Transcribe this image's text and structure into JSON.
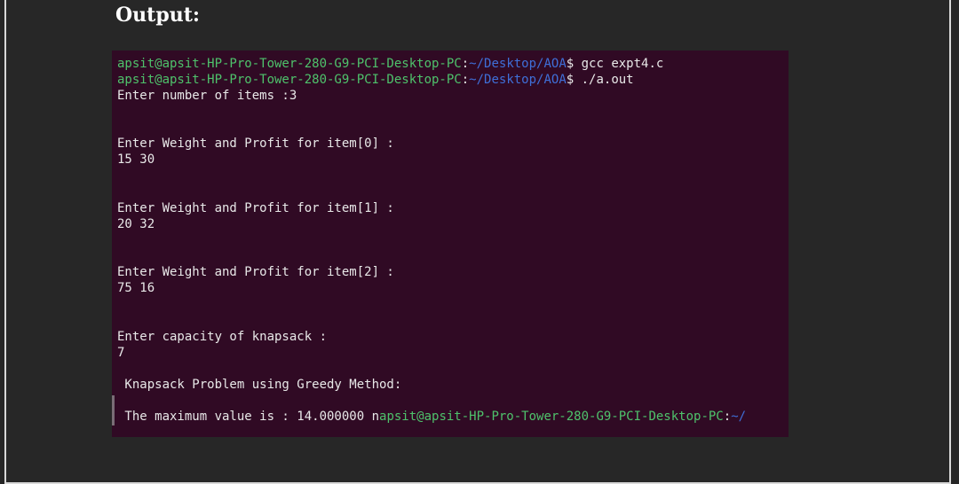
{
  "heading": "Output:",
  "terminal": {
    "lines": [
      {
        "user": "apsit@apsit-HP-Pro-Tower-280-G9-PCI-Desktop-PC",
        "sep": ":",
        "path": "~/Desktop/AOA",
        "rest": "$ gcc expt4.c"
      },
      {
        "user": "apsit@apsit-HP-Pro-Tower-280-G9-PCI-Desktop-PC",
        "sep": ":",
        "path": "~/Desktop/AOA",
        "rest": "$ ./a.out"
      },
      {
        "text": "Enter number of items :3"
      },
      {
        "text": "Enter Weight and Profit for item[0] :"
      },
      {
        "text": "15 30"
      },
      {
        "text": "Enter Weight and Profit for item[1] :"
      },
      {
        "text": "20 32"
      },
      {
        "text": "Enter Weight and Profit for item[2] :"
      },
      {
        "text": "75 16"
      },
      {
        "text": "Enter capacity of knapsack :"
      },
      {
        "text": "7"
      },
      {
        "text": " Knapsack Problem using Greedy Method:"
      },
      {
        "text": " The maximum value is : 14.000000 n",
        "user": "apsit@apsit-HP-Pro-Tower-280-G9-PCI-Desktop-PC",
        "sep": ":",
        "path": "~/"
      }
    ]
  },
  "colors": {
    "terminal_bg": "#300a24",
    "prompt_user": "#4ec26b",
    "prompt_path": "#3f6fd8",
    "text": "#e8e8e8"
  }
}
